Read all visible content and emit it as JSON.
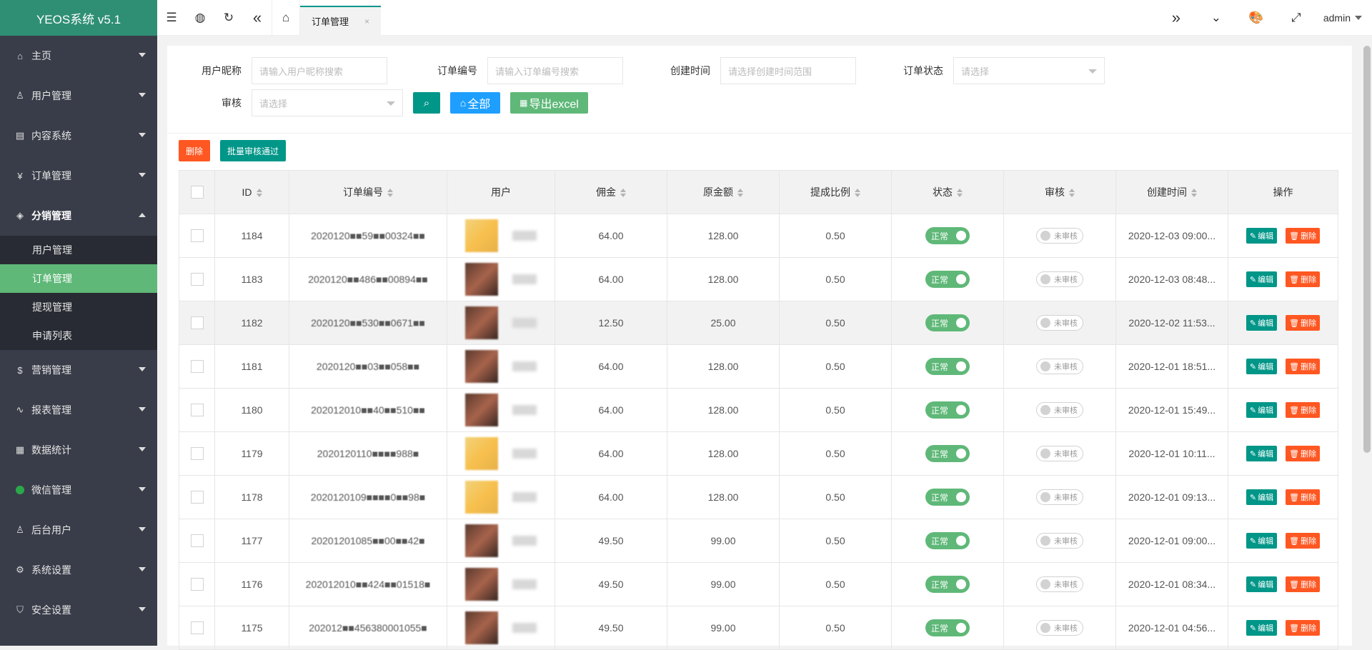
{
  "app": {
    "title": "YEOS系统 v5.1"
  },
  "sidebar": {
    "items": [
      {
        "label": "主页",
        "icon": "home-icon"
      },
      {
        "label": "用户管理",
        "icon": "user-icon"
      },
      {
        "label": "内容系统",
        "icon": "content-icon"
      },
      {
        "label": "订单管理",
        "icon": "yen-icon"
      },
      {
        "label": "分销管理",
        "icon": "cube-icon"
      },
      {
        "label": "营销管理",
        "icon": "dollar-icon"
      },
      {
        "label": "报表管理",
        "icon": "chart-icon"
      },
      {
        "label": "数据统计",
        "icon": "grid-icon"
      },
      {
        "label": "微信管理",
        "icon": "wechat-icon"
      },
      {
        "label": "后台用户",
        "icon": "user-icon"
      },
      {
        "label": "系统设置",
        "icon": "gear-icon"
      },
      {
        "label": "安全设置",
        "icon": "shield-icon"
      }
    ],
    "sub": [
      "用户管理",
      "订单管理",
      "提现管理",
      "申请列表"
    ]
  },
  "topbar": {
    "tab_label": "订单管理",
    "tab_close": "×",
    "user": "admin"
  },
  "filters": {
    "nickname_label": "用户昵称",
    "nickname_placeholder": "请输入用户昵称搜索",
    "order_no_label": "订单编号",
    "order_no_placeholder": "请输入订单编号搜索",
    "created_label": "创建时间",
    "created_placeholder": "请选择创建时间范围",
    "status_label": "订单状态",
    "status_placeholder": "请选择",
    "audit_label": "审核",
    "audit_placeholder": "请选择",
    "all_label": "全部",
    "export_label": "导出excel"
  },
  "actions": {
    "delete": "删除",
    "batch_approve": "批量审核通过"
  },
  "table": {
    "headers": {
      "id": "ID",
      "order_no": "订单编号",
      "user": "用户",
      "commission": "佣金",
      "original": "原金额",
      "ratio": "提成比例",
      "status": "状态",
      "audit": "审核",
      "created": "创建时间",
      "ops": "操作"
    },
    "status_on": "正常",
    "audit_off": "未审核",
    "edit": "编辑",
    "del": "删除",
    "rows": [
      {
        "id": "1184",
        "order_no": "2020120■■59■■00324■■",
        "commission": "64.00",
        "original": "128.00",
        "ratio": "0.50",
        "created": "2020-12-03 09:00...",
        "avatar": "y"
      },
      {
        "id": "1183",
        "order_no": "2020120■■486■■00894■■",
        "commission": "64.00",
        "original": "128.00",
        "ratio": "0.50",
        "created": "2020-12-03 08:48...",
        "avatar": "b"
      },
      {
        "id": "1182",
        "order_no": "2020120■■530■■0671■■",
        "commission": "12.50",
        "original": "25.00",
        "ratio": "0.50",
        "created": "2020-12-02 11:53...",
        "avatar": "b"
      },
      {
        "id": "1181",
        "order_no": "2020120■■03■■058■■",
        "commission": "64.00",
        "original": "128.00",
        "ratio": "0.50",
        "created": "2020-12-01 18:51...",
        "avatar": "b"
      },
      {
        "id": "1180",
        "order_no": "202012010■■40■■510■■",
        "commission": "64.00",
        "original": "128.00",
        "ratio": "0.50",
        "created": "2020-12-01 15:49...",
        "avatar": "b"
      },
      {
        "id": "1179",
        "order_no": "2020120110■■■■988■",
        "commission": "64.00",
        "original": "128.00",
        "ratio": "0.50",
        "created": "2020-12-01 10:11...",
        "avatar": "y"
      },
      {
        "id": "1178",
        "order_no": "2020120109■■■■0■■98■",
        "commission": "64.00",
        "original": "128.00",
        "ratio": "0.50",
        "created": "2020-12-01 09:13...",
        "avatar": "y"
      },
      {
        "id": "1177",
        "order_no": "20201201085■■00■■42■",
        "commission": "49.50",
        "original": "99.00",
        "ratio": "0.50",
        "created": "2020-12-01 09:00...",
        "avatar": "b"
      },
      {
        "id": "1176",
        "order_no": "202012010■■424■■01518■",
        "commission": "49.50",
        "original": "99.00",
        "ratio": "0.50",
        "created": "2020-12-01 08:34...",
        "avatar": "b"
      },
      {
        "id": "1175",
        "order_no": "202012■■456380001055■",
        "commission": "49.50",
        "original": "99.00",
        "ratio": "0.50",
        "created": "2020-12-01 04:56...",
        "avatar": "b"
      }
    ]
  }
}
